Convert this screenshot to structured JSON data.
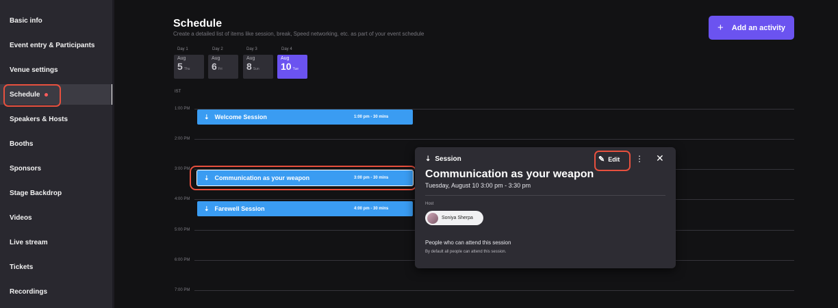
{
  "sidebar": {
    "items": [
      {
        "label": "Basic info"
      },
      {
        "label": "Event entry & Participants"
      },
      {
        "label": "Venue settings"
      },
      {
        "label": "Schedule"
      },
      {
        "label": "Speakers & Hosts"
      },
      {
        "label": "Booths"
      },
      {
        "label": "Sponsors"
      },
      {
        "label": "Stage Backdrop"
      },
      {
        "label": "Videos"
      },
      {
        "label": "Live stream"
      },
      {
        "label": "Tickets"
      },
      {
        "label": "Recordings"
      }
    ],
    "active": "Schedule"
  },
  "header": {
    "title": "Schedule",
    "subtitle": "Create a detailed list of items like session, break, Speed networking, etc. as part of your event schedule",
    "add_button": "Add an activity"
  },
  "days": [
    {
      "label": "Day 1",
      "month": "Aug",
      "date": "5",
      "weekday": "Thu"
    },
    {
      "label": "Day 2",
      "month": "Aug",
      "date": "6",
      "weekday": "Fri"
    },
    {
      "label": "Day 3",
      "month": "Aug",
      "date": "8",
      "weekday": "Sun"
    },
    {
      "label": "Day 4",
      "month": "Aug",
      "date": "10",
      "weekday": "Tue"
    }
  ],
  "selected_day": "Day 4",
  "timeline": {
    "timezone": "IST",
    "times": [
      "1:00 PM",
      "2:00 PM",
      "3:00 PM",
      "4:00 PM",
      "5:00 PM",
      "6:00 PM",
      "7:00 PM"
    ]
  },
  "events": [
    {
      "title": "Welcome Session",
      "time": "1:00 pm - 30 mins"
    },
    {
      "title": "Communication as your weapon",
      "time": "3:00 pm - 30 mins"
    },
    {
      "title": "Farewell Session",
      "time": "4:00 pm - 30 mins"
    }
  ],
  "popup": {
    "type": "Session",
    "edit_label": "Edit",
    "title": "Communication as your weapon",
    "datetime": "Tuesday, August 10   3:00 pm - 3:30 pm",
    "host_label": "Host",
    "host_name": "Soniya Sherpa",
    "attend_heading": "People who can attend this session",
    "attend_note": "By default all people can attend this session."
  },
  "icons": {
    "session": "session-icon",
    "edit": "pencil-icon",
    "more": "more-vertical-icon",
    "close": "close-icon",
    "add": "plus-icon"
  },
  "colors": {
    "accent": "#6b53f0",
    "event": "#3a9cf2",
    "highlight": "#e8503e",
    "notification_dot": "#ff5c5c"
  }
}
